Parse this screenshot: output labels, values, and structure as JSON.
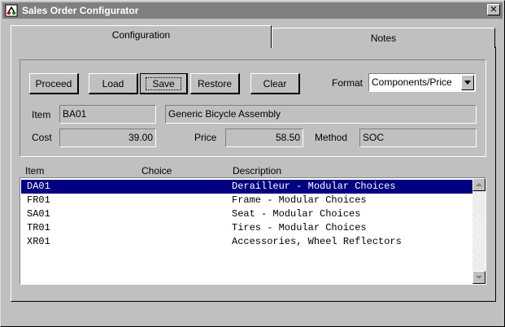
{
  "window": {
    "title": "Sales Order Configurator",
    "close_glyph": "✕",
    "icon": "app-icon"
  },
  "tabs": [
    {
      "label": "Configuration",
      "active": true
    },
    {
      "label": "Notes",
      "active": false
    }
  ],
  "toolbar": {
    "proceed": "Proceed",
    "load": "Load",
    "save": "Save",
    "restore": "Restore",
    "clear": "Clear",
    "format_label": "Format",
    "format_value": "Components/Price"
  },
  "item": {
    "label": "Item",
    "code": "BA01",
    "description": "Generic Bicycle Assembly"
  },
  "pricing": {
    "cost_label": "Cost",
    "cost": "39.00",
    "price_label": "Price",
    "price": "58.50",
    "method_label": "Method",
    "method": "SOC"
  },
  "list": {
    "headers": {
      "item": "Item",
      "choice": "Choice",
      "description": "Description"
    },
    "rows": [
      {
        "item": "DA01",
        "choice": "",
        "description": "Derailleur - Modular Choices",
        "selected": true
      },
      {
        "item": "FR01",
        "choice": "",
        "description": "Frame - Modular Choices",
        "selected": false
      },
      {
        "item": "SA01",
        "choice": "",
        "description": "Seat - Modular Choices",
        "selected": false
      },
      {
        "item": "TR01",
        "choice": "",
        "description": "Tires - Modular Choices",
        "selected": false
      },
      {
        "item": "XR01",
        "choice": "",
        "description": "Accessories, Wheel Reflectors",
        "selected": false
      }
    ]
  },
  "colors": {
    "selection": "#000080",
    "titlebar_inactive": "#808080",
    "face": "#c0c0c0"
  }
}
